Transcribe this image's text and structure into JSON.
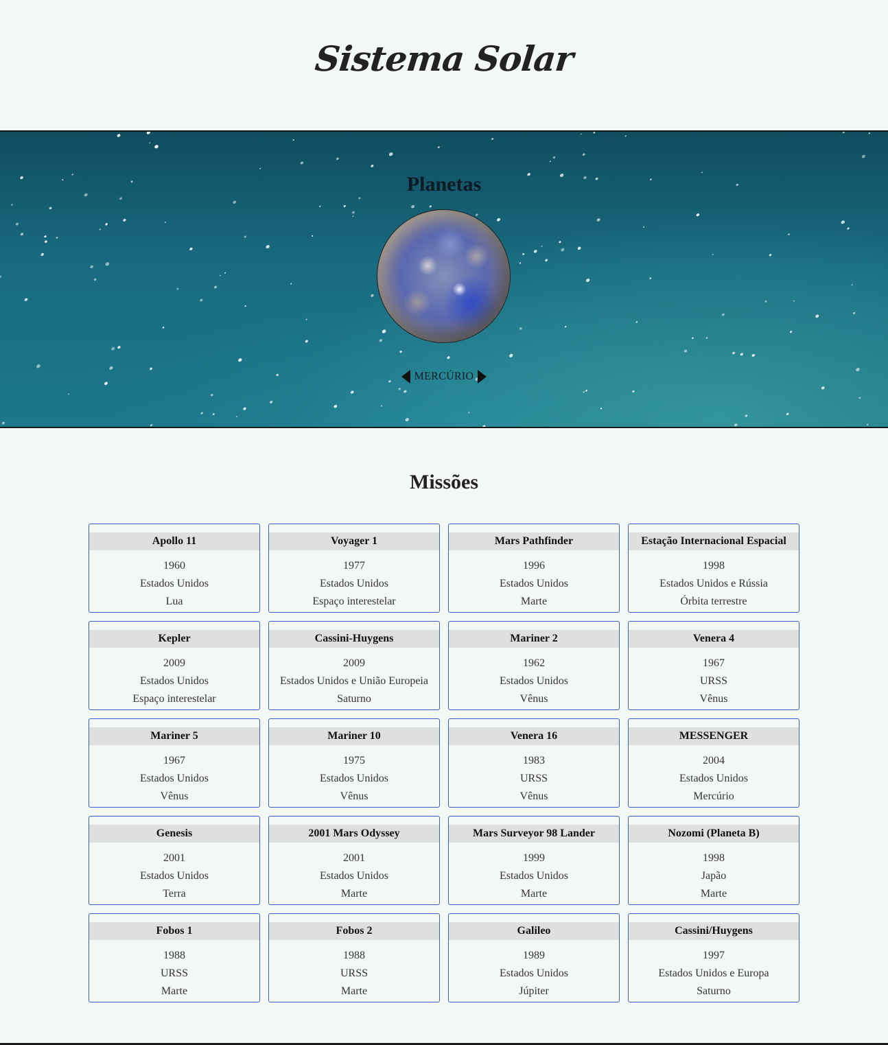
{
  "header": {
    "title": "Sistema Solar"
  },
  "planets": {
    "title": "Planetas",
    "current_planet": "MERCÚRIO",
    "prev_icon": "triangle-left",
    "next_icon": "triangle-right"
  },
  "missions": {
    "title": "Missões",
    "items": [
      {
        "name": "Apollo 11",
        "year": "1960",
        "country": "Estados Unidos",
        "destination": "Lua"
      },
      {
        "name": "Voyager 1",
        "year": "1977",
        "country": "Estados Unidos",
        "destination": "Espaço interestelar"
      },
      {
        "name": "Mars Pathfinder",
        "year": "1996",
        "country": "Estados Unidos",
        "destination": "Marte"
      },
      {
        "name": "Estação Internacional Espacial",
        "year": "1998",
        "country": "Estados Unidos e Rússia",
        "destination": "Órbita terrestre"
      },
      {
        "name": "Kepler",
        "year": "2009",
        "country": "Estados Unidos",
        "destination": "Espaço interestelar"
      },
      {
        "name": "Cassini-Huygens",
        "year": "2009",
        "country": "Estados Unidos e União Europeia",
        "destination": "Saturno"
      },
      {
        "name": "Mariner 2",
        "year": "1962",
        "country": "Estados Unidos",
        "destination": "Vênus"
      },
      {
        "name": "Venera 4",
        "year": "1967",
        "country": "URSS",
        "destination": "Vênus"
      },
      {
        "name": "Mariner 5",
        "year": "1967",
        "country": "Estados Unidos",
        "destination": "Vênus"
      },
      {
        "name": "Mariner 10",
        "year": "1975",
        "country": "Estados Unidos",
        "destination": "Vênus"
      },
      {
        "name": "Venera 16",
        "year": "1983",
        "country": "URSS",
        "destination": "Vênus"
      },
      {
        "name": "MESSENGER",
        "year": "2004",
        "country": "Estados Unidos",
        "destination": "Mercúrio"
      },
      {
        "name": "Genesis",
        "year": "2001",
        "country": "Estados Unidos",
        "destination": "Terra"
      },
      {
        "name": "2001 Mars Odyssey",
        "year": "2001",
        "country": "Estados Unidos",
        "destination": "Marte"
      },
      {
        "name": "Mars Surveyor 98 Lander",
        "year": "1999",
        "country": "Estados Unidos",
        "destination": "Marte"
      },
      {
        "name": "Nozomi (Planeta B)",
        "year": "1998",
        "country": "Japão",
        "destination": "Marte"
      },
      {
        "name": "Fobos 1",
        "year": "1988",
        "country": "URSS",
        "destination": "Marte"
      },
      {
        "name": "Fobos 2",
        "year": "1988",
        "country": "URSS",
        "destination": "Marte"
      },
      {
        "name": "Galileo",
        "year": "1989",
        "country": "Estados Unidos",
        "destination": "Júpiter"
      },
      {
        "name": "Cassini/Huygens",
        "year": "1997",
        "country": "Estados Unidos e Europa",
        "destination": "Saturno"
      }
    ]
  },
  "colors": {
    "card_border": "#3a5fcd",
    "card_header_bg": "#dde0df",
    "page_bg": "#f4f8f5"
  }
}
